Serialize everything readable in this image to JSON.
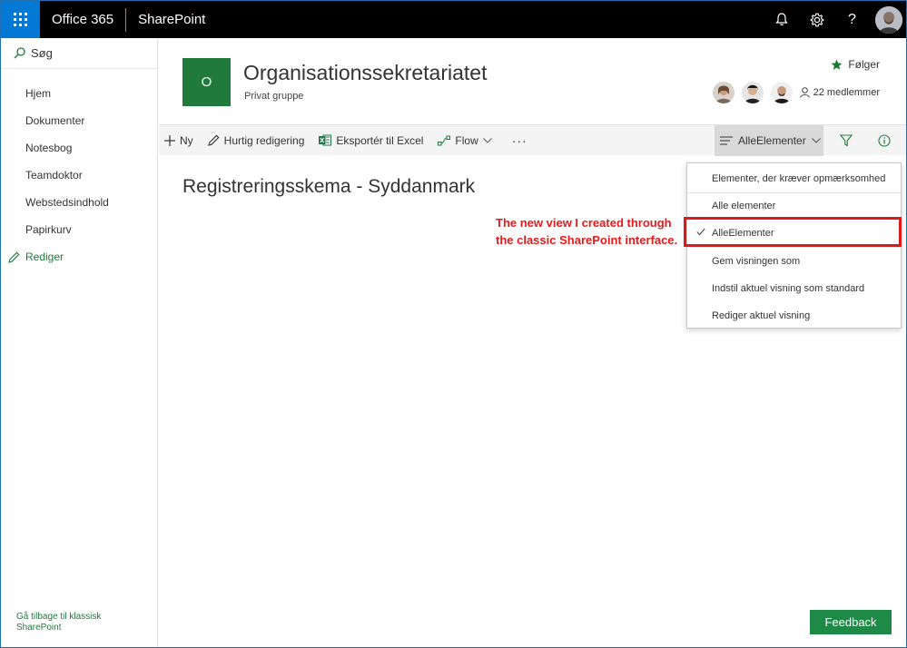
{
  "suite": {
    "brand": "Office 365",
    "app": "SharePoint"
  },
  "leftnav": {
    "search_label": "Søg",
    "items": [
      {
        "label": "Hjem"
      },
      {
        "label": "Dokumenter"
      },
      {
        "label": "Notesbog"
      },
      {
        "label": "Teamdoktor"
      },
      {
        "label": "Webstedsindhold"
      },
      {
        "label": "Papirkurv"
      }
    ],
    "edit_label": "Rediger",
    "classic_link": "Gå tilbage til klassisk SharePoint"
  },
  "header": {
    "logo_letter": "O",
    "title": "Organisationssekretariatet",
    "subtitle": "Privat gruppe",
    "follow_label": "Følger",
    "members_label": "22 medlemmer"
  },
  "commandbar": {
    "new_label": "Ny",
    "quick_edit_label": "Hurtig redigering",
    "export_label": "Eksportér til Excel",
    "flow_label": "Flow",
    "more_label": "···",
    "view_label": "AlleElementer"
  },
  "main": {
    "list_title": "Registreringsskema - Syddanmark",
    "annotation": "The new view I created through the classic SharePoint interface."
  },
  "view_menu": {
    "items": [
      {
        "label": "Elementer, der kræver opmærksomhed"
      },
      {
        "label": "Alle elementer"
      },
      {
        "label": "AlleElementer",
        "checked": true
      },
      {
        "label": "Gem visningen som"
      },
      {
        "label": "Indstil aktuel visning som standard"
      },
      {
        "label": "Rediger aktuel visning"
      }
    ]
  },
  "feedback_label": "Feedback",
  "colors": {
    "suite_bar": "#000000",
    "waffle": "#0078d4",
    "site_green": "#1f7a3b",
    "feedback_green": "#1f8a48",
    "annotation_red": "#e8191b"
  }
}
